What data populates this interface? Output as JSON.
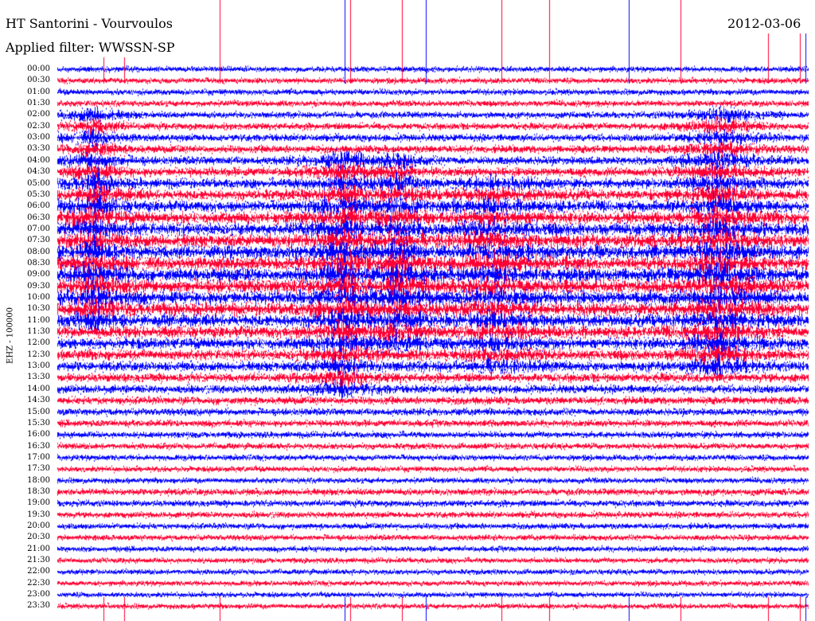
{
  "header": {
    "station": "HT Santorini - Vourvoulos",
    "filter": "Applied filter: WWSSN-SP",
    "date": "2012-03-06"
  },
  "chart_data": {
    "type": "line",
    "title": "HT Santorini - Vourvoulos",
    "subtitle": "Applied filter: WWSSN-SP",
    "ylabel": "EHZ - 100000",
    "y_ticks": [
      "00:00",
      "00:30",
      "01:00",
      "01:30",
      "02:00",
      "02:30",
      "03:00",
      "03:30",
      "04:00",
      "04:30",
      "05:00",
      "05:30",
      "06:00",
      "06:30",
      "07:00",
      "07:30",
      "08:00",
      "08:30",
      "09:00",
      "09:30",
      "10:00",
      "10:30",
      "11:00",
      "11:30",
      "12:00",
      "12:30",
      "13:00",
      "13:30",
      "14:00",
      "14:30",
      "15:00",
      "15:30",
      "16:00",
      "16:30",
      "17:00",
      "17:30",
      "18:00",
      "18:30",
      "19:00",
      "19:30",
      "20:00",
      "20:30",
      "21:00",
      "21:30",
      "22:00",
      "22:30",
      "23:00",
      "23:30"
    ],
    "series": [
      {
        "color": "#0000ff"
      },
      {
        "color": "#ff0033"
      }
    ],
    "row_colors": [
      "#0000ff",
      "#ff0033"
    ],
    "grid": false,
    "legend": "none"
  }
}
